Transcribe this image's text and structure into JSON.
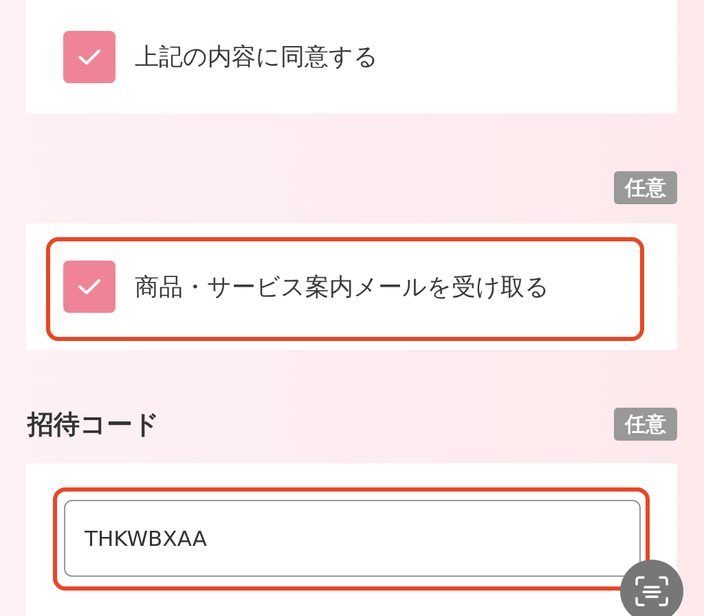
{
  "consent": {
    "label": "上記の内容に同意する",
    "checked": true
  },
  "newsletter": {
    "badge": "任意",
    "label": "商品・サービス案内メールを受け取る",
    "checked": true,
    "highlighted": true
  },
  "invite_code": {
    "title": "招待コード",
    "badge": "任意",
    "value": "THKWBXAA",
    "highlighted": true
  }
}
